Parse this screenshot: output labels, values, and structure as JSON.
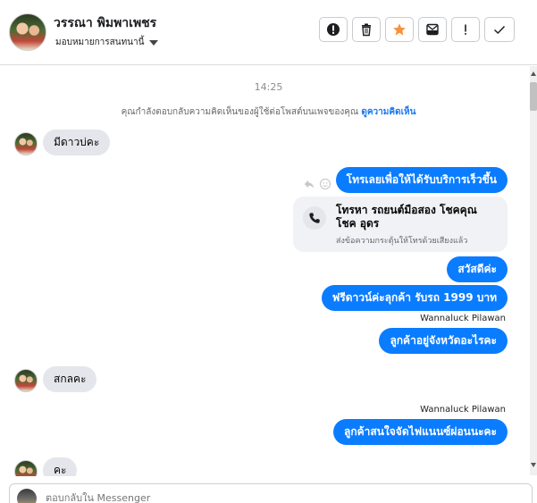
{
  "header": {
    "name": "วรรณา พิมพาเพชร",
    "assign_label": "มอบหมายการสนทนานี้",
    "actions": [
      {
        "icon": "alert-circle-icon"
      },
      {
        "icon": "trash-icon"
      },
      {
        "icon": "star-icon",
        "color": "#f7923a"
      },
      {
        "icon": "archive-mail-icon"
      },
      {
        "icon": "exclamation-icon"
      },
      {
        "icon": "check-icon"
      }
    ]
  },
  "chat": {
    "timestamp": "14:25",
    "notice_text": "คุณกำลังตอบกลับความคิดเห็นของผู้ใช้ต่อโพสต์บนเพจของคุณ",
    "notice_link": "ดูความคิดเห็น",
    "messages": [
      {
        "dir": "in",
        "text": "มีดาวบ่คะ"
      },
      {
        "dir": "out",
        "text": "โทรเลยเพื่อให้ได้รับบริการเร็วขึ้น"
      },
      {
        "dir": "card",
        "title": "โทรหา รถยนต์มือสอง โชคคุณ โชค อุดร",
        "subtitle": "ส่งข้อความกระตุ้นให้โทรด้วยเสียงแล้ว"
      },
      {
        "dir": "out",
        "text": "สวัสดีค่ะ"
      },
      {
        "dir": "out",
        "text": "ฟรีดาวน์ค่ะลุกค้า  รับรถ 1999 บาท"
      },
      {
        "dir": "sender",
        "text": "Wannaluck Pilawan"
      },
      {
        "dir": "out",
        "text": "ลูกค้าอยู่จังหวัดอะไรคะ"
      },
      {
        "dir": "in",
        "text": "สกลคะ"
      },
      {
        "dir": "sender",
        "text": "Wannaluck Pilawan"
      },
      {
        "dir": "out",
        "text": "ลูกค้าสนใจจัดไฟแนนซ์ผ่อนนะคะ"
      },
      {
        "dir": "in",
        "text": "คะ"
      }
    ]
  },
  "composer": {
    "placeholder": "ตอบกลับใน Messenger"
  },
  "colors": {
    "outgoing_bubble": "#0a7cff",
    "incoming_bubble": "#e4e6eb",
    "link": "#1877f2"
  }
}
